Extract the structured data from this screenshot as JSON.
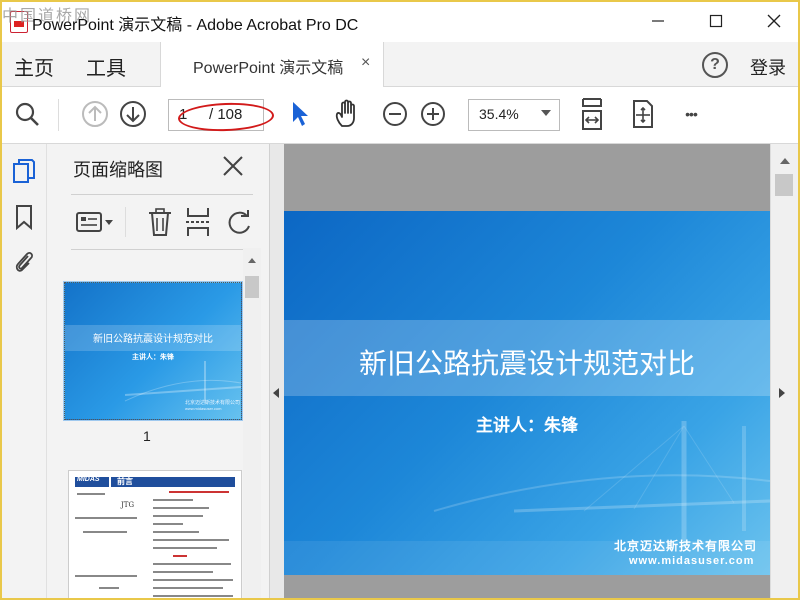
{
  "window": {
    "watermark": "中国道桥网",
    "title": "PowerPoint 演示文稿 - Adobe Acrobat Pro DC"
  },
  "menu": {
    "home": "主页",
    "tools": "工具",
    "doc_tab": "PowerPoint 演示文稿",
    "doc_tab_close": "×",
    "help": "?",
    "login": "登录"
  },
  "toolbar": {
    "page_current": "1",
    "page_total": "/ 108",
    "zoom": "35.4%",
    "more": "•••"
  },
  "thumbnails_panel": {
    "title": "页面缩略图",
    "thumb1_number": "1",
    "thumb1_title": "新旧公路抗震设计规范对比",
    "thumb1_subtitle": "主讲人：朱锋",
    "thumb1_company": "北京迈达斯技术有限公司",
    "thumb1_website": "www.midasuser.com",
    "thumb2_logo": "MIDAS",
    "thumb2_header": "前言",
    "thumb2_code": "JTG"
  },
  "slide": {
    "title": "新旧公路抗震设计规范对比",
    "subtitle": "主讲人：朱锋",
    "company": "北京迈达斯技术有限公司",
    "website": "www.midasuser.com"
  },
  "colors": {
    "accent_blue": "#1473c9",
    "annotation_red": "#d21a1a",
    "border_yellow": "#e9c84a"
  }
}
